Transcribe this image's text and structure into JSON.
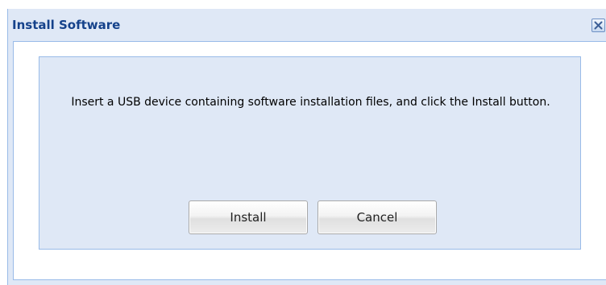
{
  "dialog": {
    "title": "Install Software",
    "close_icon": "close-icon",
    "message": "Insert a USB device containing software installation files, and click the Install button.",
    "buttons": {
      "install_label": "Install",
      "cancel_label": "Cancel"
    }
  },
  "colors": {
    "title_text": "#15428b",
    "panel_background": "#dfe8f6",
    "panel_border": "#99bbe8"
  }
}
